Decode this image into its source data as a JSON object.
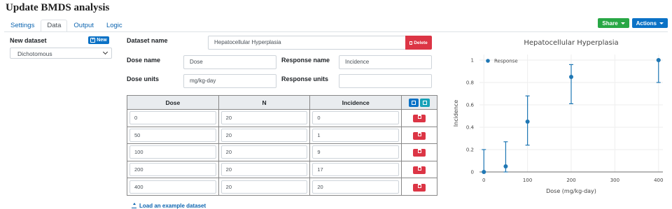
{
  "app": {
    "title": "Update BMDS analysis"
  },
  "tabs": [
    {
      "label": "Settings"
    },
    {
      "label": "Data"
    },
    {
      "label": "Output"
    },
    {
      "label": "Logic"
    }
  ],
  "toolbar": {
    "share_label": "Share",
    "actions_label": "Actions"
  },
  "left_panel": {
    "new_dataset_label": "New dataset",
    "new_button_label": "New",
    "dataset_type": "Dichotomous"
  },
  "form": {
    "dataset_name_label": "Dataset name",
    "dataset_name_value": "Hepatocellular Hyperplasia",
    "delete_label": "Delete",
    "dose_name_label": "Dose name",
    "dose_name_value": "Dose",
    "response_name_label": "Response name",
    "response_name_value": "Incidence",
    "dose_units_label": "Dose units",
    "dose_units_value": "mg/kg-day",
    "response_units_label": "Response units",
    "response_units_value": ""
  },
  "table": {
    "headers": [
      "Dose",
      "N",
      "Incidence"
    ],
    "rows": [
      [
        "0",
        "20",
        "0"
      ],
      [
        "50",
        "20",
        "1"
      ],
      [
        "100",
        "20",
        "9"
      ],
      [
        "200",
        "20",
        "17"
      ],
      [
        "400",
        "20",
        "20"
      ]
    ]
  },
  "load_example_label": "Load an example dataset",
  "colors": {
    "series": "#1f77b4",
    "danger": "#dc3545",
    "primary": "#0b72c6",
    "success": "#28a745"
  },
  "chart_data": {
    "type": "scatter",
    "title": "Hepatocellular Hyperplasia",
    "xlabel": "Dose (mg/kg-day)",
    "ylabel": "Incidence",
    "xlim": [
      -10,
      410
    ],
    "ylim": [
      0,
      1.05
    ],
    "x_ticks": [
      0,
      100,
      200,
      300,
      400
    ],
    "y_ticks": [
      0,
      0.2,
      0.4,
      0.6,
      0.8,
      1
    ],
    "legend_position": "top-left",
    "grid": true,
    "series": [
      {
        "name": "Response",
        "x": [
          0,
          50,
          100,
          200,
          400
        ],
        "y": [
          0,
          0.05,
          0.45,
          0.85,
          1.0
        ],
        "lower": [
          0,
          0,
          0.24,
          0.61,
          0.8
        ],
        "upper": [
          0.2,
          0.27,
          0.68,
          0.96,
          1.0
        ]
      }
    ]
  }
}
